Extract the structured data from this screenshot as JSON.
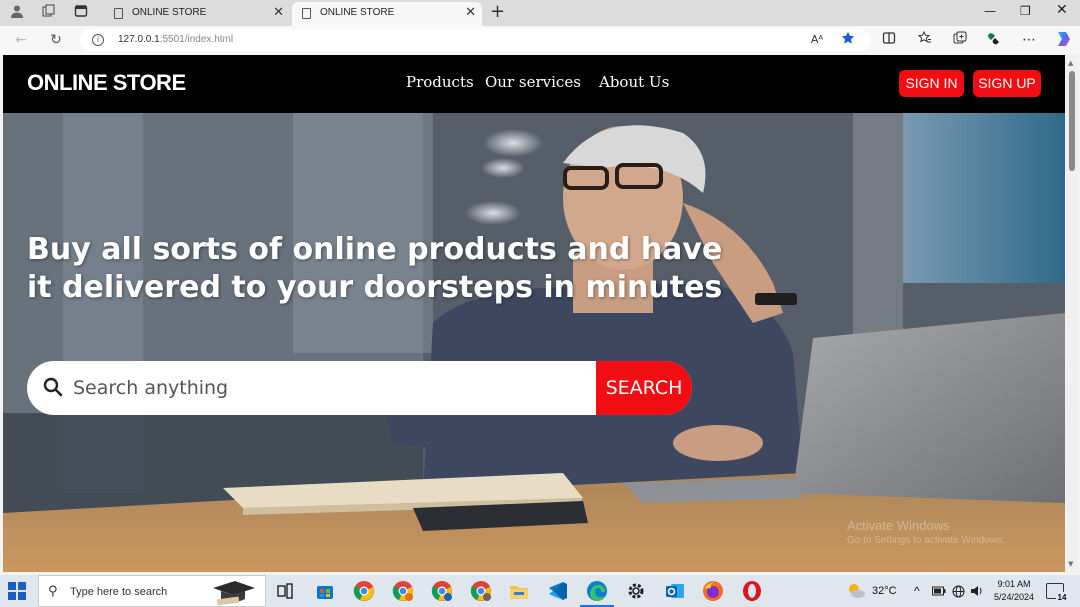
{
  "browser": {
    "tabs": [
      {
        "title": "ONLINE STORE",
        "active": false
      },
      {
        "title": "ONLINE STORE",
        "active": true
      }
    ],
    "url_host": "127.0.0.1",
    "url_rest": ":5501/index.html",
    "read_aloud_label": "Aᴬ"
  },
  "site": {
    "logo": "ONLINE STORE",
    "nav": [
      "Products",
      "Our services",
      "About Us"
    ],
    "sign_in": "SIGN IN",
    "sign_up": "SIGN UP",
    "hero_title": "Buy all sorts of online products and have it delivered to your doorsteps in minutes",
    "search_placeholder": "Search anything",
    "search_button": "SEARCH",
    "accent_color": "#f20d13",
    "nav_background": "#000000"
  },
  "watermark": {
    "line1": "Activate Windows",
    "line2": "Go to Settings to activate Windows."
  },
  "taskbar": {
    "search_text": "Type here to search",
    "weather_temp": "32°C",
    "time": "9:01 AM",
    "date": "5/24/2024",
    "notification_count": "14"
  },
  "icons": [
    "profile-icon",
    "workspaces-icon",
    "tab-actions-icon",
    "back-icon",
    "refresh-icon",
    "info-icon",
    "favorite-star-icon",
    "split-screen-icon",
    "favorites-icon",
    "collections-icon",
    "extensions-icon",
    "more-icon",
    "copilot-icon",
    "search-icon",
    "windows-start-icon"
  ]
}
